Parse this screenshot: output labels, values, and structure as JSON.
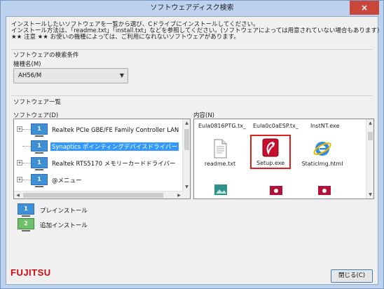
{
  "window": {
    "title": "ソフトウェアディスク検索",
    "close_glyph": "×"
  },
  "instructions": [
    "インストールしたいソフトウェアを一覧から選び、Cドライブにインストールしてください。",
    "インストール方法は、「readme.txt」「install.txt」などを参照してください。(ソフトウェアによっては用意されていない場合もあります)",
    "★★ 注意 ★★ お使いの機種によっては、ご利用になれないソフトウェアがあります。"
  ],
  "search_conditions": {
    "title": "ソフトウェアの検索条件",
    "model_label": "機種名(M)",
    "model_value": "AH56/M"
  },
  "software_list": {
    "title": "ソフトウェア一覧",
    "software_label": "ソフトウェア(D)",
    "contents_label": "内容(N)",
    "tree_items": [
      {
        "label": "Realtek PCIe GBE/FE Family Controller LAN ドラ",
        "expander": "+",
        "icon": "preinstall-icon",
        "selected": false
      },
      {
        "label": "Synaptics ポインティングデバイスドライバー",
        "expander": "",
        "icon": "preinstall-icon",
        "selected": true
      },
      {
        "label": "Realtek RTS5170 メモリーカードドライバー",
        "expander": "+",
        "icon": "preinstall-icon",
        "selected": false
      },
      {
        "label": "@メニュー",
        "expander": "+",
        "icon": "preinstall-icon",
        "selected": false
      }
    ],
    "top_files": [
      "Eula0816PTG.tx_",
      "Eula0c0aESP.tx_",
      "InstNT.exe"
    ],
    "files": [
      {
        "name": "readme.txt",
        "icon": "text-file-icon"
      },
      {
        "name": "Setup.exe",
        "icon": "setup-icon"
      },
      {
        "name": "StaticImg.html",
        "icon": "ie-icon"
      }
    ],
    "partial_files": [
      {
        "icon": "image-file-icon"
      },
      {
        "icon": "media-file-icon"
      },
      {
        "icon": "media-file-icon"
      }
    ]
  },
  "legend": [
    {
      "label": "プレインストール",
      "icon": "preinstall-icon",
      "number": "1",
      "color": "#3d8fd6"
    },
    {
      "label": "追加インストール",
      "icon": "addinstall-icon",
      "number": "2",
      "color": "#6fc06a"
    }
  ],
  "footer": {
    "brand": "FUJITSU",
    "close_button": "閉じる(C)"
  },
  "colors": {
    "selection": "#3399ff",
    "highlight_border": "#e0201a",
    "brand_red": "#d10a11"
  }
}
